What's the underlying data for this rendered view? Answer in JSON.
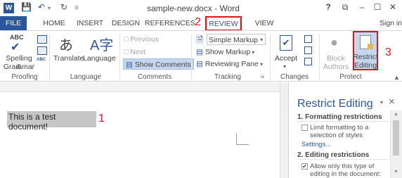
{
  "window": {
    "title": "sample-new.docx - Word",
    "controls": [
      "?",
      "⧉",
      "–",
      "☐",
      "✕"
    ]
  },
  "tabs": [
    "FILE",
    "HOME",
    "INSERT",
    "DESIGN",
    "REFERENCES",
    "REVIEW",
    "VIEW"
  ],
  "signin": "Sign in",
  "ribbon": {
    "proofing": {
      "spelling_icon_text": "ABC",
      "spelling_line1": "Spelling &",
      "spelling_line2": "Grammar",
      "label": "Proofing",
      "abc_small": "ABC"
    },
    "language": {
      "translate": "Translate",
      "language": "Language",
      "label": "Language"
    },
    "comments": {
      "previous": "Previous",
      "next": "Next",
      "show_comments": "Show Comments",
      "label": "Comments"
    },
    "tracking": {
      "markup": "Simple Markup",
      "show_markup": "Show Markup",
      "reviewing_pane": "Reviewing Pane",
      "label": "Tracking"
    },
    "changes": {
      "accept": "Accept",
      "label": "Changes"
    },
    "protect": {
      "block_line1": "Block",
      "block_line2": "Authors",
      "restrict_line1": "Restrict",
      "restrict_line2": "Editing",
      "label": "Protect"
    }
  },
  "annotations": {
    "one": "1",
    "two": "2",
    "three": "3"
  },
  "document": {
    "text": "This is a test document!"
  },
  "pane": {
    "title": "Restrict Editing",
    "section1": "1. Formatting restrictions",
    "opt1": "Limit formatting to a selection of styles",
    "settings": "Settings...",
    "section2": "2. Editing restrictions",
    "opt2": "Allow only this type of editing in the document:",
    "close": "×"
  },
  "colors": {
    "accent": "#2b579a",
    "annotation": "#e0141e"
  }
}
